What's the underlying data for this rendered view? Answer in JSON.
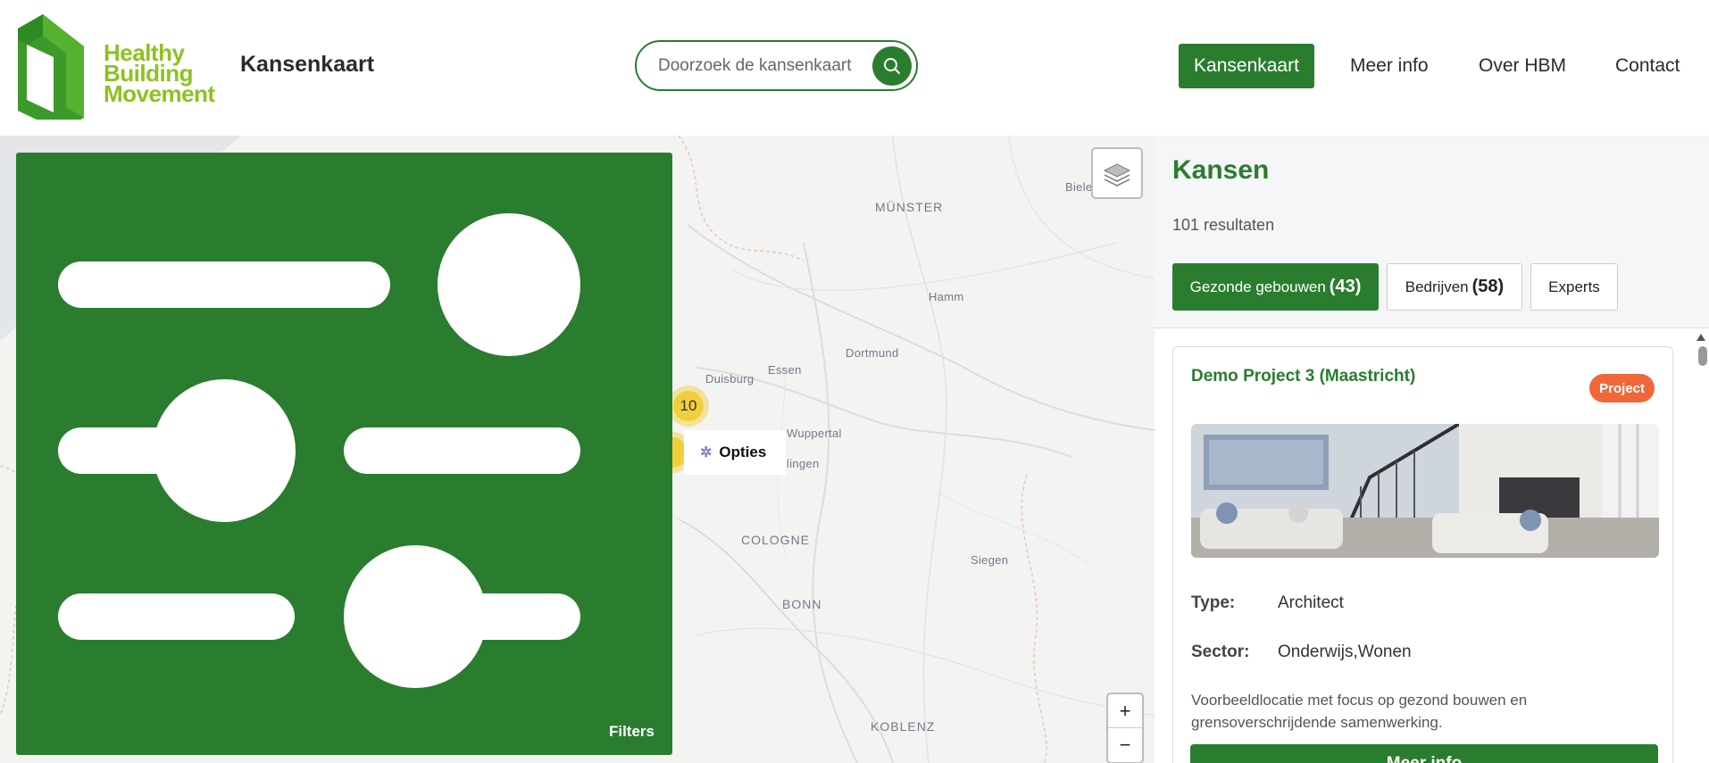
{
  "header": {
    "logo_lines": [
      "Healthy",
      "Building",
      "Movement"
    ],
    "app_title": "Kansenkaart",
    "search": {
      "placeholder": "Doorzoek de kansenkaart",
      "value": ""
    },
    "nav": [
      {
        "label": "Kansenkaart",
        "active": true
      },
      {
        "label": "Meer info",
        "active": false
      },
      {
        "label": "Over HBM",
        "active": false
      },
      {
        "label": "Contact",
        "active": false
      }
    ]
  },
  "map": {
    "cities": [
      "MÜNSTER",
      "Hamm",
      "Dortmund",
      "Duisburg",
      "Essen",
      "Wuppertal",
      "lingen",
      "COLOGNE",
      "Siegen",
      "BONN",
      "KOBLENZ",
      "Biele"
    ],
    "cluster_count": "10",
    "options_label": "Opties",
    "zoom_in": "+",
    "zoom_out": "−",
    "filters_label": "Filters"
  },
  "panel": {
    "title": "Kansen",
    "results": "101 resultaten",
    "tabs": [
      {
        "label": "Gezonde gebouwen",
        "count": "(43)",
        "active": true
      },
      {
        "label": "Bedrijven",
        "count": "(58)",
        "active": false
      },
      {
        "label": "Experts",
        "count": "",
        "active": false
      }
    ],
    "card": {
      "title": "Demo Project 3 (Maastricht)",
      "badge": "Project",
      "type_label": "Type:",
      "type_value": "Architect",
      "sector_label": "Sector:",
      "sector_value": "Onderwijs,Wonen",
      "description": "Voorbeeldlocatie met focus op gezond bouwen en grensoverschrijdende samenwerking.",
      "button": "Meer info"
    }
  },
  "colors": {
    "brand_green": "#2a7d2e",
    "logo_green": "#8dc21f",
    "badge_orange": "#f0683a",
    "cluster_yellow": "#f1cf3c"
  }
}
